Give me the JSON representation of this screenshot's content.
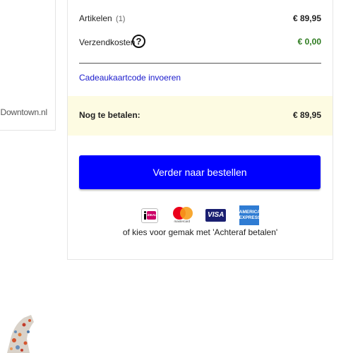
{
  "store": {
    "name": "Downtown.nl"
  },
  "summary": {
    "articles_label": "Artikelen",
    "articles_count": "(1)",
    "articles_value": "€ 89,95",
    "shipping_label": "Verzendkosten",
    "shipping_help": "?",
    "shipping_value": "€ 0,00",
    "gift_link": "Cadeaukaartcode invoeren",
    "total_label": "Nog te betalen:",
    "total_value": "€ 89,95",
    "order_button": "Verder naar bestellen",
    "payment_methods": [
      {
        "name": "iDEAL",
        "label": "iDEAL",
        "icon": "ideal-logo"
      },
      {
        "name": "Mastercard",
        "label": "mastercard",
        "icon": "mastercard-logo"
      },
      {
        "name": "Visa",
        "label": "VISA",
        "icon": "visa-logo"
      },
      {
        "name": "American Express",
        "label": "AMERICAN EXPRESS",
        "icon": "amex-logo"
      }
    ],
    "payment_note": "of kies voor gemak met 'Achteraf betalen'"
  },
  "colors": {
    "button": "#0000ff",
    "link": "#1a1acc",
    "free_shipping": "#2c7a1e",
    "total_background": "#fdfbe2"
  }
}
